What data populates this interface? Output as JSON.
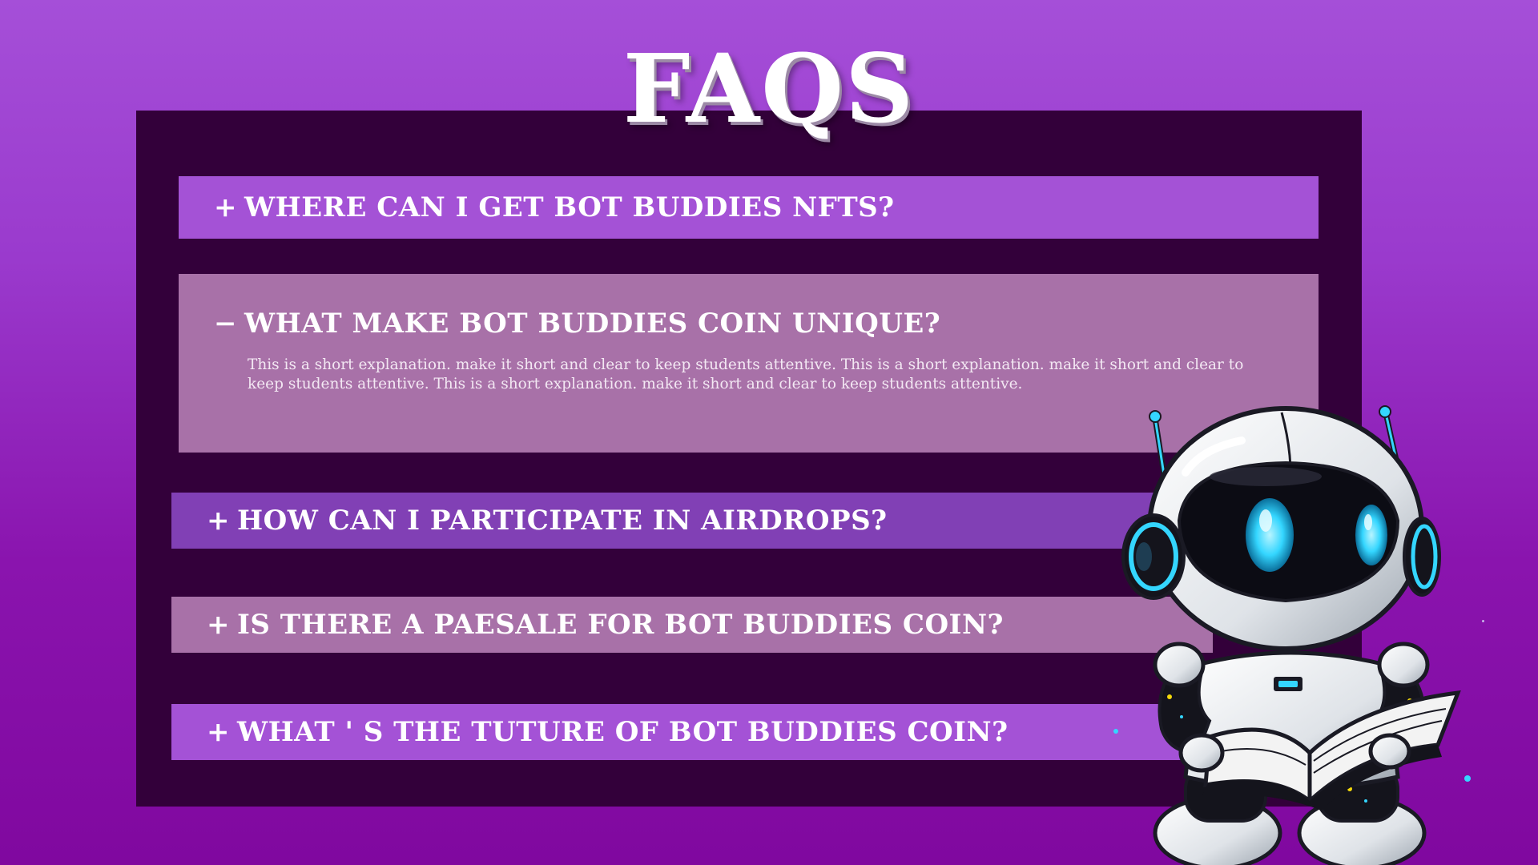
{
  "page": {
    "title": "FAQS"
  },
  "faqs": [
    {
      "sign": "+",
      "question": "WHERE CAN I GET BOT BUDDIES NFTS?",
      "expanded": false
    },
    {
      "sign": "−",
      "question": "WHAT MAKE BOT BUDDIES COIN UNIQUE?",
      "expanded": true,
      "answer": "This is a short explanation. make it short and clear to keep students attentive. This is a short explanation. make it short and clear to keep students attentive. This is a short explanation. make it short and clear to keep students attentive."
    },
    {
      "sign": "+",
      "question": "HOW CAN I PARTICIPATE IN AIRDROPS?",
      "expanded": false
    },
    {
      "sign": "+",
      "question": "IS THERE A PAESALE FOR BOT BUDDIES COIN?",
      "expanded": false
    },
    {
      "sign": "+",
      "question": "WHAT ' S THE TUTURE OF BOT BUDDIES COIN?",
      "expanded": false
    }
  ],
  "colors": {
    "background_top": "#a54fd8",
    "background_bottom": "#80089f",
    "panel": "#33003a",
    "faq_purple": "#a452d6",
    "faq_mauve": "#a871a8",
    "faq_violet": "#8140b5",
    "robot_eye_glow": "#34d6ff"
  },
  "illustration": {
    "name": "robot-reading-book-mascot"
  }
}
